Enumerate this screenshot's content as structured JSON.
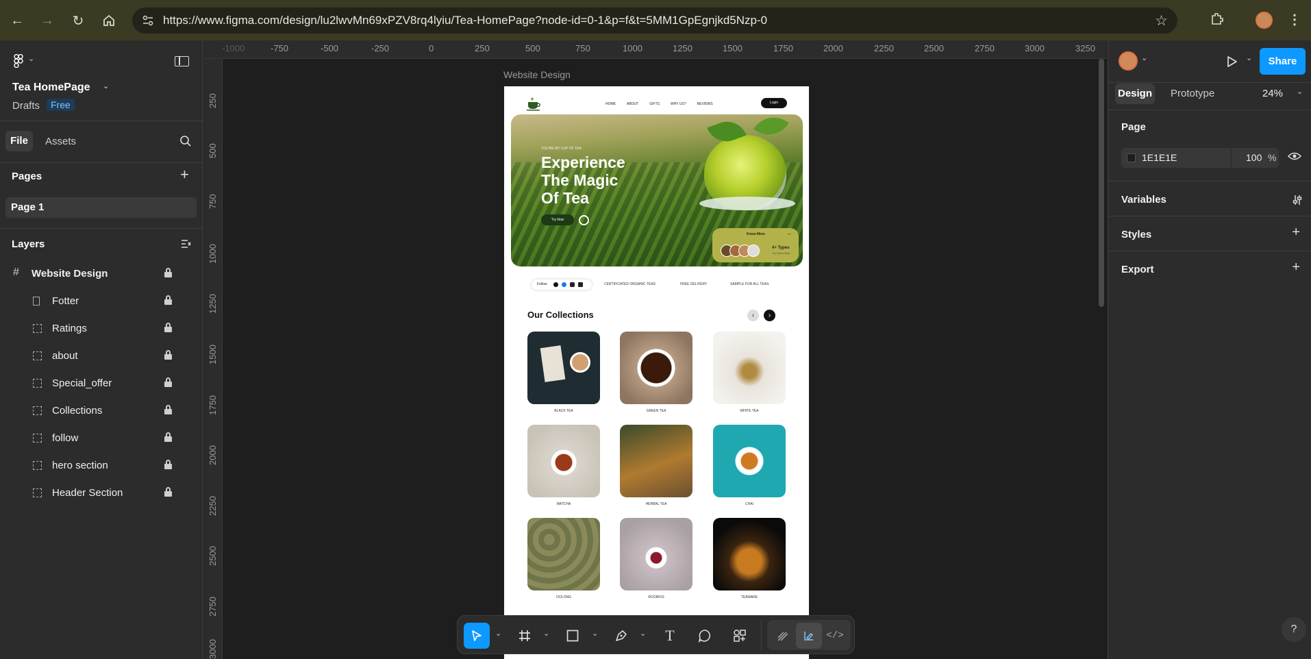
{
  "browser": {
    "url": "https://www.figma.com/design/lu2lwvMn69xPZV8rq4lyiu/Tea-HomePage?node-id=0-1&p=f&t=5MM1GpEgnjkd5Nzp-0"
  },
  "left_panel": {
    "file_name": "Tea HomePage",
    "location": "Drafts",
    "plan_badge": "Free",
    "tab_file": "File",
    "tab_assets": "Assets",
    "pages_heading": "Pages",
    "pages": [
      "Page 1"
    ],
    "layers_heading": "Layers",
    "root_layer": "Website Design",
    "layers": [
      "Fotter",
      "Ratings",
      "about",
      "Special_offer",
      "Collections",
      "follow",
      "hero section",
      "Header Section"
    ]
  },
  "rulers": {
    "horizontal": [
      "-1000",
      "-750",
      "-500",
      "-250",
      "0",
      "250",
      "500",
      "750",
      "1000",
      "1250",
      "1500",
      "1750",
      "2000",
      "2250",
      "2500",
      "2750",
      "3000",
      "3250"
    ],
    "vertical": [
      "250",
      "500",
      "750",
      "1000",
      "1250",
      "1500",
      "1750",
      "2000",
      "2250",
      "2500",
      "2750",
      "3000"
    ]
  },
  "canvas": {
    "frame_label": "Website Design",
    "site": {
      "nav": [
        "HOME",
        "ABOUT",
        "GIFTS",
        "WHY US?",
        "REVIEWS"
      ],
      "login": "Login",
      "hero_kicker": "YOU'RE MY CUP OF TEA",
      "hero_title_1": "Experience",
      "hero_title_2": "The Magic",
      "hero_title_3": "Of Tea",
      "hero_button": "Try Now",
      "know_more": "Know More",
      "types_count": "4+ Types",
      "types_sub": "Try Them Now",
      "follow_label": "Follow",
      "badges": [
        "CERTIFICATED ORGANIC TEAS",
        "FREE DELIVERY",
        "SAMPLE FOR ALL TEAS"
      ],
      "collections_title": "Our Collections",
      "collections": [
        "BLACK TEA",
        "GREEN TEA",
        "WHITE TEA",
        "MATCHA",
        "HERBAL TEA",
        "CHAI",
        "OOLONG",
        "ROOIBOS",
        "TEAWARE"
      ]
    }
  },
  "right_panel": {
    "tab_design": "Design",
    "tab_prototype": "Prototype",
    "zoom": "24%",
    "share": "Share",
    "page_heading": "Page",
    "bg_color": "1E1E1E",
    "bg_opacity": "100",
    "percent": "%",
    "variables": "Variables",
    "styles": "Styles",
    "export": "Export"
  },
  "help": "?",
  "colors": {
    "accent": "#0d99ff",
    "canvas": "#1e1e1e",
    "panel": "#2c2c2c",
    "browser_bar": "#3b3a22"
  }
}
